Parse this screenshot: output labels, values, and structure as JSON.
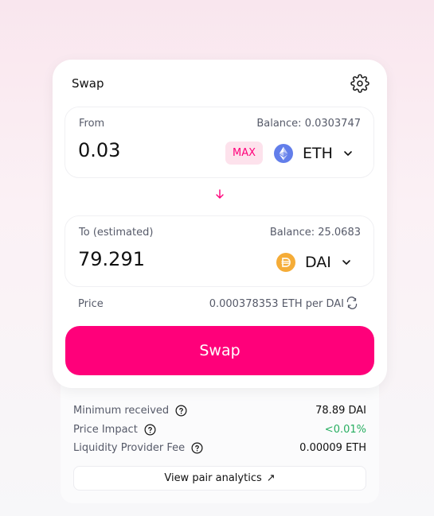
{
  "swap": {
    "title": "Swap",
    "settings_icon": "gear-icon",
    "from": {
      "label": "From",
      "balance": "Balance: 0.0303747",
      "amount": "0.03",
      "max_label": "MAX",
      "token": "ETH",
      "token_icon": "ethereum-icon"
    },
    "to": {
      "label": "To (estimated)",
      "balance": "Balance: 25.0683",
      "amount": "79.291",
      "token": "DAI",
      "token_icon": "dai-icon"
    },
    "price_label": "Price",
    "price_value": "0.000378353 ETH per DAI",
    "swap_button": "Swap"
  },
  "details": {
    "rows": [
      {
        "label": "Minimum received",
        "value": "78.89 DAI"
      },
      {
        "label": "Price Impact",
        "value": "<0.01%"
      },
      {
        "label": "Liquidity Provider Fee",
        "value": "0.00009 ETH"
      }
    ],
    "analytics_link": "View pair analytics",
    "analytics_icon": "↗"
  },
  "colors": {
    "accent": "#ff007a",
    "accent_soft": "#fde2ec",
    "positive": "#27ae60",
    "muted_text": "#565a69"
  }
}
